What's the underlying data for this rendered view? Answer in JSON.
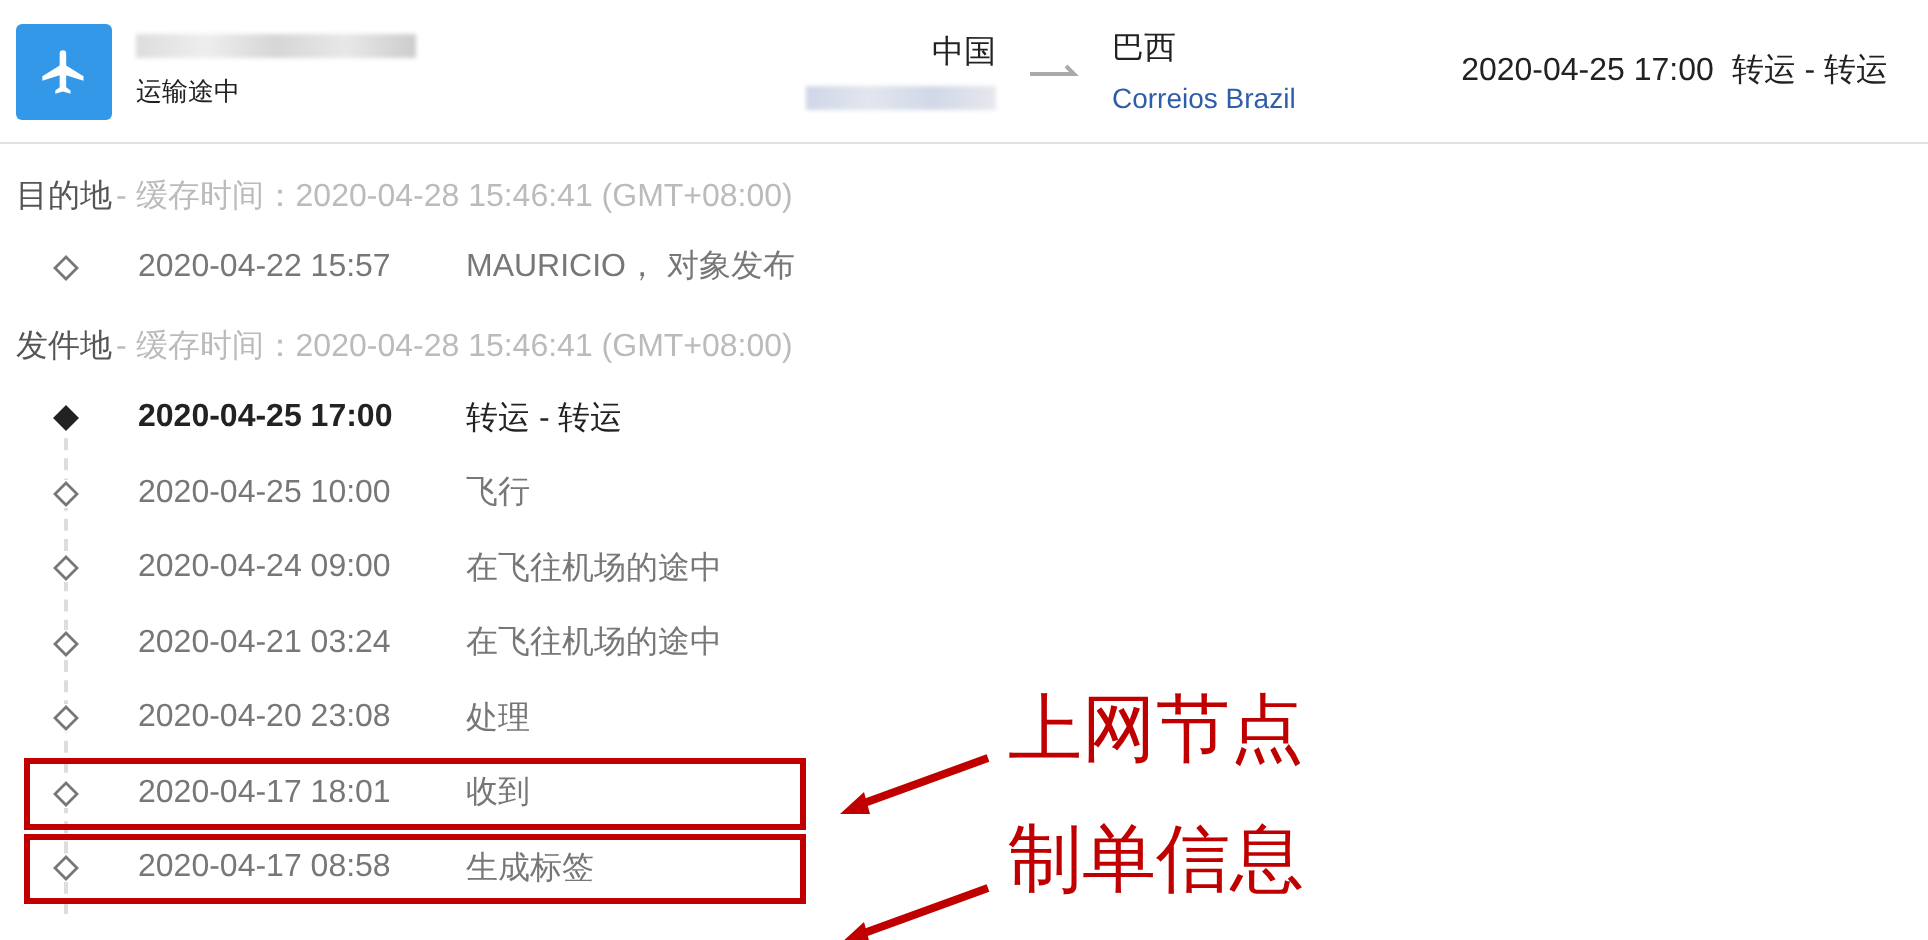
{
  "shipment": {
    "status": "运输途中",
    "origin": "中国",
    "destination": "巴西",
    "carrier": "Correios Brazil",
    "latest_time": "2020-04-25 17:00",
    "latest_event": "转运 - 转运"
  },
  "sections": [
    {
      "title": "目的地",
      "cache_label": "- 缓存时间：2020-04-28 15:46:41 (GMT+08:00)",
      "events": [
        {
          "time": "2020-04-22 15:57",
          "description": "MAURICIO， 对象发布",
          "current": false,
          "highlighted": false
        }
      ]
    },
    {
      "title": "发件地",
      "cache_label": "- 缓存时间：2020-04-28 15:46:41 (GMT+08:00)",
      "events": [
        {
          "time": "2020-04-25 17:00",
          "description": "转运 - 转运",
          "current": true,
          "highlighted": false
        },
        {
          "time": "2020-04-25 10:00",
          "description": "飞行",
          "current": false,
          "highlighted": false
        },
        {
          "time": "2020-04-24 09:00",
          "description": "在飞往机场的途中",
          "current": false,
          "highlighted": false
        },
        {
          "time": "2020-04-21 03:24",
          "description": "在飞往机场的途中",
          "current": false,
          "highlighted": false
        },
        {
          "time": "2020-04-20 23:08",
          "description": "处理",
          "current": false,
          "highlighted": false
        },
        {
          "time": "2020-04-17 18:01",
          "description": "收到",
          "current": false,
          "highlighted": true
        },
        {
          "time": "2020-04-17 08:58",
          "description": "生成标签",
          "current": false,
          "highlighted": true
        }
      ]
    }
  ],
  "annotations": [
    {
      "text": "上网节点"
    },
    {
      "text": "制单信息"
    }
  ]
}
